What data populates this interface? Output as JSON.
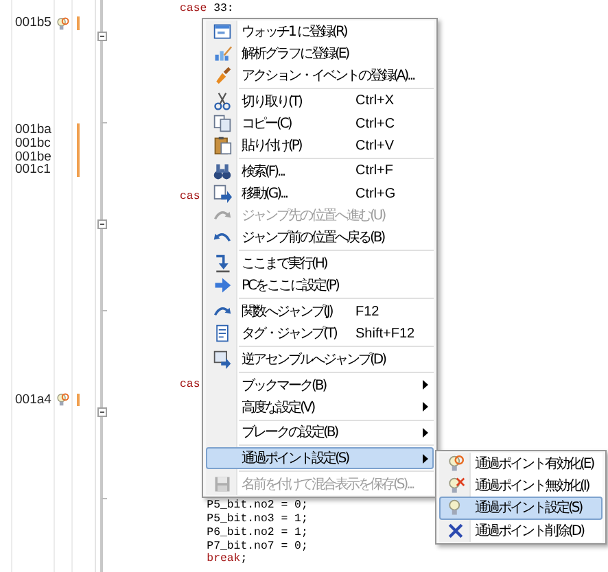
{
  "editor": {
    "lines": [
      {
        "kind": "line",
        "passpoint": false,
        "marker": false,
        "code": [
          {
            "kind": "keyword",
            "text": "case"
          },
          {
            "kind": "plain",
            "text": " 33:"
          }
        ]
      },
      {
        "kind": "line",
        "address": "001b5",
        "passpoint": true,
        "marker": true
      },
      {
        "kind": "fold_start",
        "passpoint": false,
        "marker": false
      },
      {
        "kind": "line",
        "passpoint": false,
        "marker": false
      },
      {
        "kind": "line",
        "passpoint": false,
        "marker": false
      },
      {
        "kind": "line",
        "passpoint": false,
        "marker": false
      },
      {
        "kind": "line",
        "passpoint": false,
        "marker": false
      },
      {
        "kind": "line",
        "passpoint": false,
        "marker": false
      },
      {
        "kind": "fold_end",
        "passpoint": false,
        "marker": false
      },
      {
        "kind": "line",
        "address": "001ba",
        "passpoint": false,
        "marker": true
      },
      {
        "kind": "line",
        "address": "001bc",
        "passpoint": false,
        "marker": true
      },
      {
        "kind": "line",
        "address": "001be",
        "passpoint": false,
        "marker": true
      },
      {
        "kind": "line",
        "address": "001c1",
        "passpoint": false,
        "marker": true
      },
      {
        "kind": "line",
        "passpoint": false,
        "marker": false
      },
      {
        "kind": "line",
        "passpoint": false,
        "marker": false,
        "code": [
          {
            "kind": "keyword",
            "text": "cas"
          }
        ]
      },
      {
        "kind": "line",
        "passpoint": false,
        "marker": false
      },
      {
        "kind": "fold_start",
        "passpoint": false,
        "marker": false
      },
      {
        "kind": "line",
        "passpoint": false,
        "marker": false
      },
      {
        "kind": "line",
        "passpoint": false,
        "marker": false
      },
      {
        "kind": "line",
        "passpoint": false,
        "marker": false
      },
      {
        "kind": "line",
        "passpoint": false,
        "marker": false
      },
      {
        "kind": "line",
        "passpoint": false,
        "marker": false
      },
      {
        "kind": "fold_end",
        "passpoint": false,
        "marker": false
      },
      {
        "kind": "line",
        "passpoint": false,
        "marker": false
      },
      {
        "kind": "line",
        "passpoint": false,
        "marker": false
      },
      {
        "kind": "line",
        "passpoint": false,
        "marker": false
      },
      {
        "kind": "line",
        "passpoint": false,
        "marker": false
      },
      {
        "kind": "line",
        "passpoint": false,
        "marker": false
      },
      {
        "kind": "line",
        "passpoint": false,
        "marker": false,
        "code": [
          {
            "kind": "keyword",
            "text": "cas"
          }
        ]
      },
      {
        "kind": "line",
        "address": "001a4",
        "passpoint": true,
        "marker": true
      },
      {
        "kind": "fold_start",
        "passpoint": false,
        "marker": false
      },
      {
        "kind": "line",
        "passpoint": false,
        "marker": false
      },
      {
        "kind": "line",
        "passpoint": false,
        "marker": false
      },
      {
        "kind": "line",
        "passpoint": false,
        "marker": false
      },
      {
        "kind": "line",
        "passpoint": false,
        "marker": false
      },
      {
        "kind": "line",
        "passpoint": false,
        "marker": false
      },
      {
        "kind": "fold_end",
        "passpoint": false,
        "marker": false
      },
      {
        "kind": "line",
        "passpoint": false,
        "marker": false,
        "code": [
          {
            "kind": "plain",
            "text": "    P5_bit.no2 = 0;"
          }
        ]
      },
      {
        "kind": "line",
        "passpoint": false,
        "marker": false,
        "code": [
          {
            "kind": "plain",
            "text": "    P5_bit.no3 = 1;"
          }
        ]
      },
      {
        "kind": "line",
        "passpoint": false,
        "marker": false,
        "code": [
          {
            "kind": "plain",
            "text": "    P6_bit.no2 = 1;"
          }
        ]
      },
      {
        "kind": "line",
        "passpoint": false,
        "marker": false,
        "code": [
          {
            "kind": "plain",
            "text": "    P7_bit.no7 = 0;"
          }
        ]
      },
      {
        "kind": "line",
        "passpoint": false,
        "marker": false,
        "code": [
          {
            "kind": "keyword",
            "text": "    break"
          },
          {
            "kind": "plain",
            "text": ";"
          }
        ]
      }
    ]
  },
  "context_menu": {
    "groups": [
      {
        "items": [
          {
            "label": "ウォッチ1 に登録(R)",
            "disabled": false,
            "selected": false,
            "submenu": false
          },
          {
            "label": "解析グラフに登録(E)",
            "disabled": false,
            "selected": false,
            "submenu": false
          },
          {
            "label": "アクション・イベントの登録(A)...",
            "disabled": false,
            "selected": false,
            "submenu": false
          }
        ]
      },
      {
        "items": [
          {
            "label": "切り取り(T)",
            "shortcut": "Ctrl+X",
            "disabled": false,
            "selected": false,
            "submenu": false
          },
          {
            "label": "コピー(C)",
            "shortcut": "Ctrl+C",
            "disabled": false,
            "selected": false,
            "submenu": false
          },
          {
            "label": "貼り付け(P)",
            "shortcut": "Ctrl+V",
            "disabled": false,
            "selected": false,
            "submenu": false
          }
        ]
      },
      {
        "items": [
          {
            "label": "検索(F)...",
            "shortcut": "Ctrl+F",
            "disabled": false,
            "selected": false,
            "submenu": false
          },
          {
            "label": "移動(G)...",
            "shortcut": "Ctrl+G",
            "disabled": false,
            "selected": false,
            "submenu": false
          },
          {
            "label": "ジャンプ先の位置へ進む(U)",
            "disabled": true,
            "selected": false,
            "submenu": false
          },
          {
            "label": "ジャンプ前の位置へ戻る(B)",
            "disabled": false,
            "selected": false,
            "submenu": false
          }
        ]
      },
      {
        "items": [
          {
            "label": "ここまで実行(H)",
            "disabled": false,
            "selected": false,
            "submenu": false
          },
          {
            "label": "PCをここに設定(P)",
            "disabled": false,
            "selected": false,
            "submenu": false
          }
        ]
      },
      {
        "items": [
          {
            "label": "関数へジャンプ(J)",
            "shortcut": "F12",
            "disabled": false,
            "selected": false,
            "submenu": false
          },
          {
            "label": "タグ・ジャンプ(T)",
            "shortcut": "Shift+F12",
            "disabled": false,
            "selected": false,
            "submenu": false
          }
        ]
      },
      {
        "items": [
          {
            "label": "逆アセンブルへジャンプ(D)",
            "disabled": false,
            "selected": false,
            "submenu": false
          }
        ]
      },
      {
        "items": [
          {
            "label": "ブックマーク(B)",
            "disabled": false,
            "selected": false,
            "submenu": true
          },
          {
            "label": "高度な設定(V)",
            "disabled": false,
            "selected": false,
            "submenu": true
          }
        ]
      },
      {
        "items": [
          {
            "label": "ブレークの設定(B)",
            "disabled": false,
            "selected": false,
            "submenu": true
          }
        ]
      },
      {
        "items": [
          {
            "label": "通過ポイント設定(S)",
            "disabled": false,
            "selected": true,
            "submenu": true
          }
        ]
      },
      {
        "items": [
          {
            "label": "名前を付けて混合表示を保存(S)...",
            "disabled": true,
            "selected": false,
            "submenu": false
          }
        ]
      }
    ]
  },
  "submenu": {
    "items": [
      {
        "label": "通過ポイント有効化(E)",
        "disabled": false,
        "selected": false
      },
      {
        "label": "通過ポイント無効化(I)",
        "disabled": false,
        "selected": false
      },
      {
        "label": "通過ポイント設定(S)",
        "disabled": false,
        "selected": true
      },
      {
        "label": "通過ポイント削除(D)",
        "disabled": false,
        "selected": false
      }
    ]
  }
}
